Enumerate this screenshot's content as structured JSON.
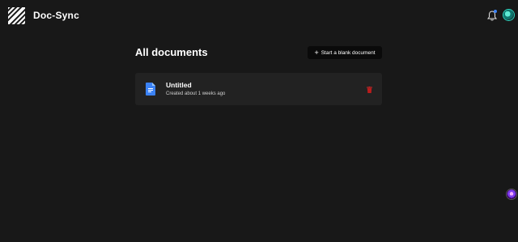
{
  "app": {
    "title": "Doc-Sync"
  },
  "header": {
    "icons": [
      "logo-icon",
      "bell-icon",
      "avatar"
    ],
    "notification_dot_color": "#3b82f6"
  },
  "main": {
    "heading": "All documents",
    "new_button_label": "Start a blank document",
    "documents": [
      {
        "title": "Untitled",
        "meta": "Created about 1 weeks ago",
        "icon": "google-doc-icon",
        "delete_icon": "trash-icon",
        "delete_color": "#dc2626"
      }
    ]
  },
  "colors": {
    "background": "#181818",
    "card": "#222222",
    "button": "#0a0a0a",
    "doc_icon_blue": "#3b82f6"
  }
}
